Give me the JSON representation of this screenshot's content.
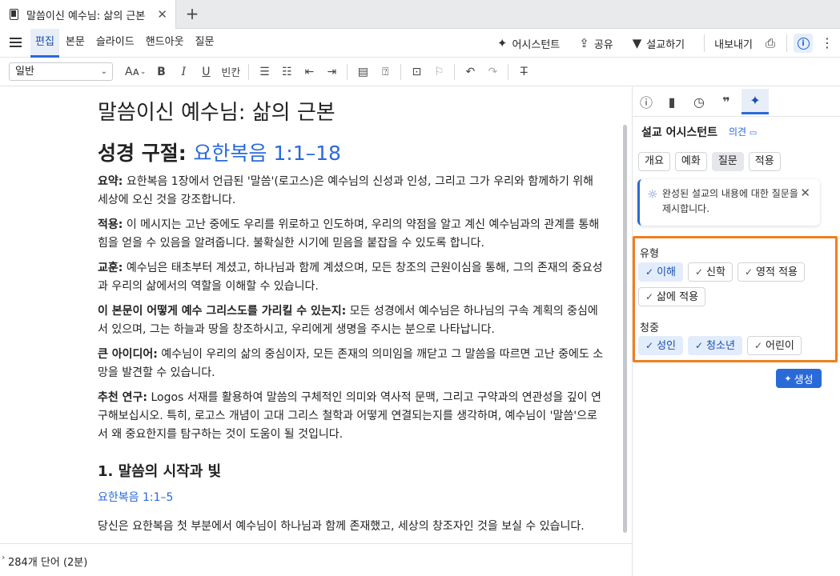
{
  "tab": {
    "title": "말씀이신 예수님: 삶의 근본",
    "close": "✕",
    "new": "+"
  },
  "nav": {
    "tabs": [
      "편집",
      "본문",
      "슬라이드",
      "핸드아웃",
      "질문"
    ],
    "assistant": "어시스턴트",
    "share": "공유",
    "preach": "설교하기",
    "export": "내보내기",
    "info": "i"
  },
  "toolbar": {
    "style": "일반",
    "font_size": "Aᴀ",
    "bold": "B",
    "italic": "I",
    "underline": "U",
    "blank": "빈칸"
  },
  "doc": {
    "title": "말씀이신 예수님: 삶의 근본",
    "scripture_label": "성경 구절:",
    "scripture_ref": "요한복음 1:1–18",
    "summary_label": "요약:",
    "summary_text": "요한복음 1장에서 언급된 '말씀'(로고스)은 예수님의 신성과 인성, 그리고 그가 우리와 함께하기 위해 세상에 오신 것을 강조합니다.",
    "application_label": "적용:",
    "application_text": "이 메시지는 고난 중에도 우리를 위로하고 인도하며, 우리의 약점을 알고 계신 예수님과의 관계를 통해 힘을 얻을 수 있음을 알려줍니다. 불확실한 시기에 믿음을 붙잡을 수 있도록 합니다.",
    "teaching_label": "교훈:",
    "teaching_text": "예수님은 태초부터 계셨고, 하나님과 함께 계셨으며, 모든 창조의 근원이심을 통해, 그의 존재의 중요성과 우리의 삶에서의 역할을 이해할 수 있습니다.",
    "christ_label": "이 본문이 어떻게 예수 그리스도를 가리킬 수 있는지:",
    "christ_text": "모든 성경에서 예수님은 하나님의 구속 계획의 중심에 서 있으며, 그는 하늘과 땅을 창조하시고, 우리에게 생명을 주시는 분으로 나타납니다.",
    "bigidea_label": "큰 아이디어:",
    "bigidea_text": "예수님이 우리의 삶의 중심이자, 모든 존재의 의미임을 깨닫고 그 말씀을 따르면 고난 중에도 소망을 발견할 수 있습니다.",
    "study_label": "추천 연구:",
    "study_text": "Logos 서재를 활용하여 말씀의 구체적인 의미와 역사적 문맥, 그리고 구약과의 연관성을 깊이 연구해보십시오. 특히, 로고스 개념이 고대 그리스 철학과 어떻게 연결되는지를 생각하며, 예수님이 '말씀'으로서 왜 중요한지를 탐구하는 것이 도움이 될 것입니다.",
    "section1_title": "1. 말씀의 시작과 빛",
    "section1_ref": "요한복음 1:1–5",
    "section1_text": "당신은 요한복음 첫 부분에서 예수님이 하나님과 함께 존재했고, 세상의 창조자인 것을 보실 수 있습니다."
  },
  "status": {
    "word_count": "284개 단어 (2분)"
  },
  "panel": {
    "title": "설교 어시스턴트",
    "feedback": "의견",
    "chips": [
      "개요",
      "예화",
      "질문",
      "적용"
    ],
    "tip": "완성된 설교의 내용에 대한 질문을 제시합니다.",
    "type_label": "유형",
    "type_options": [
      "이해",
      "신학",
      "영적 적용",
      "삶에 적용"
    ],
    "audience_label": "청중",
    "audience_options": [
      "성인",
      "청소년",
      "어린이"
    ],
    "generate": "생성"
  },
  "colors": {
    "accent": "#2a6ad8",
    "highlight_border": "#f07f1d"
  }
}
